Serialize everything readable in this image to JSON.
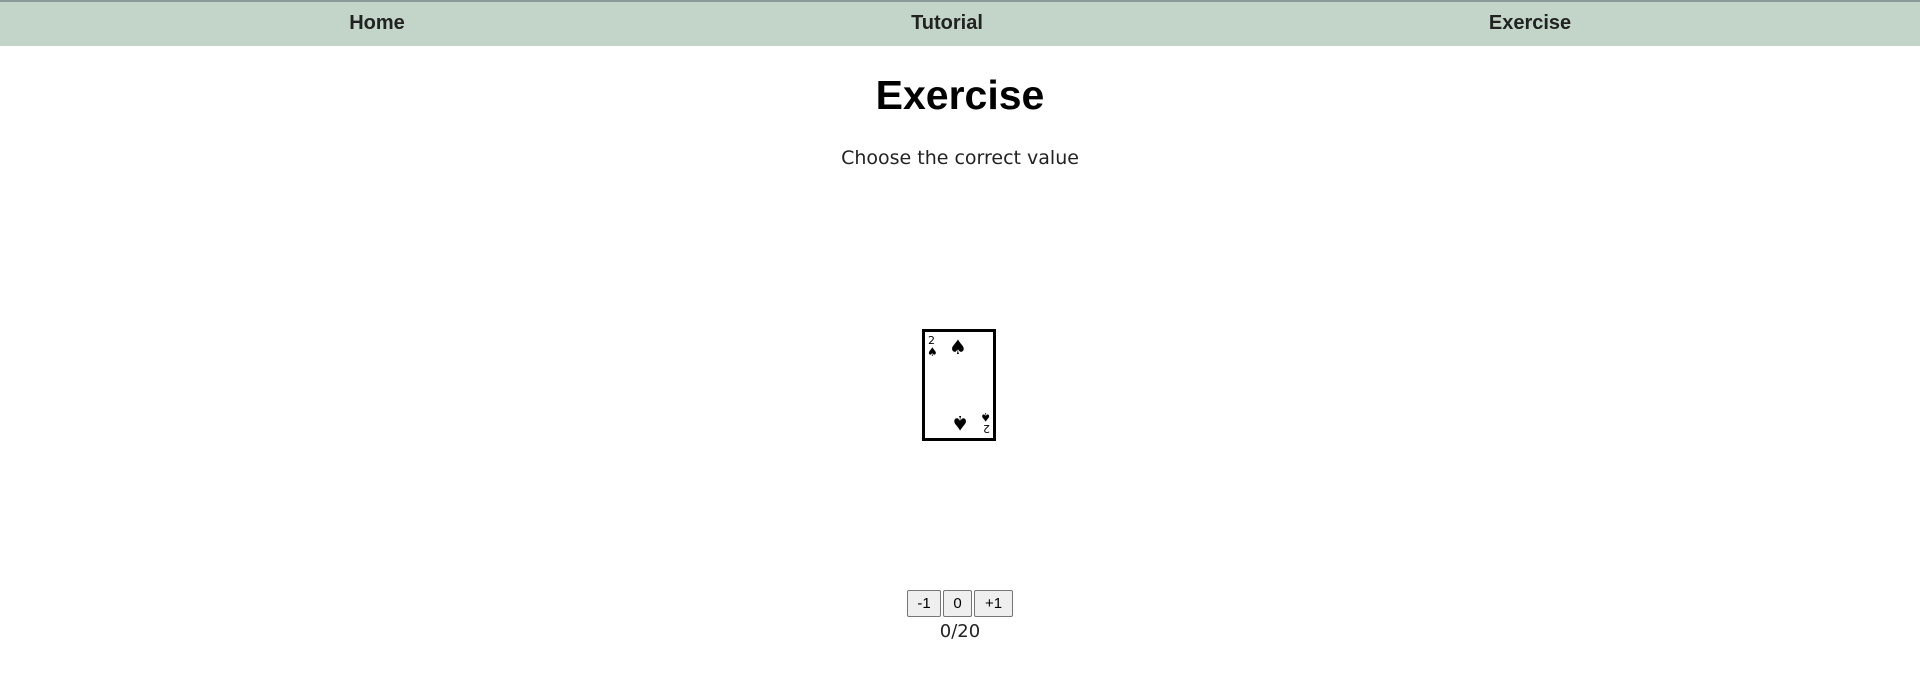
{
  "nav": {
    "items": [
      {
        "label": "Home"
      },
      {
        "label": "Tutorial"
      },
      {
        "label": "Exercise"
      }
    ]
  },
  "page": {
    "title": "Exercise",
    "instruction": "Choose the correct value"
  },
  "card": {
    "rank": "2",
    "suit": "spades",
    "suit_symbol": "♠",
    "suit_icon": "spade-icon"
  },
  "controls": {
    "minus_label": "-1",
    "zero_label": "0",
    "plus_label": "+1"
  },
  "score": {
    "text": "0/20"
  },
  "colors": {
    "navbar_bg": "#c2d5c8",
    "page_bg": "#ffffff",
    "button_bg": "#efefef"
  }
}
